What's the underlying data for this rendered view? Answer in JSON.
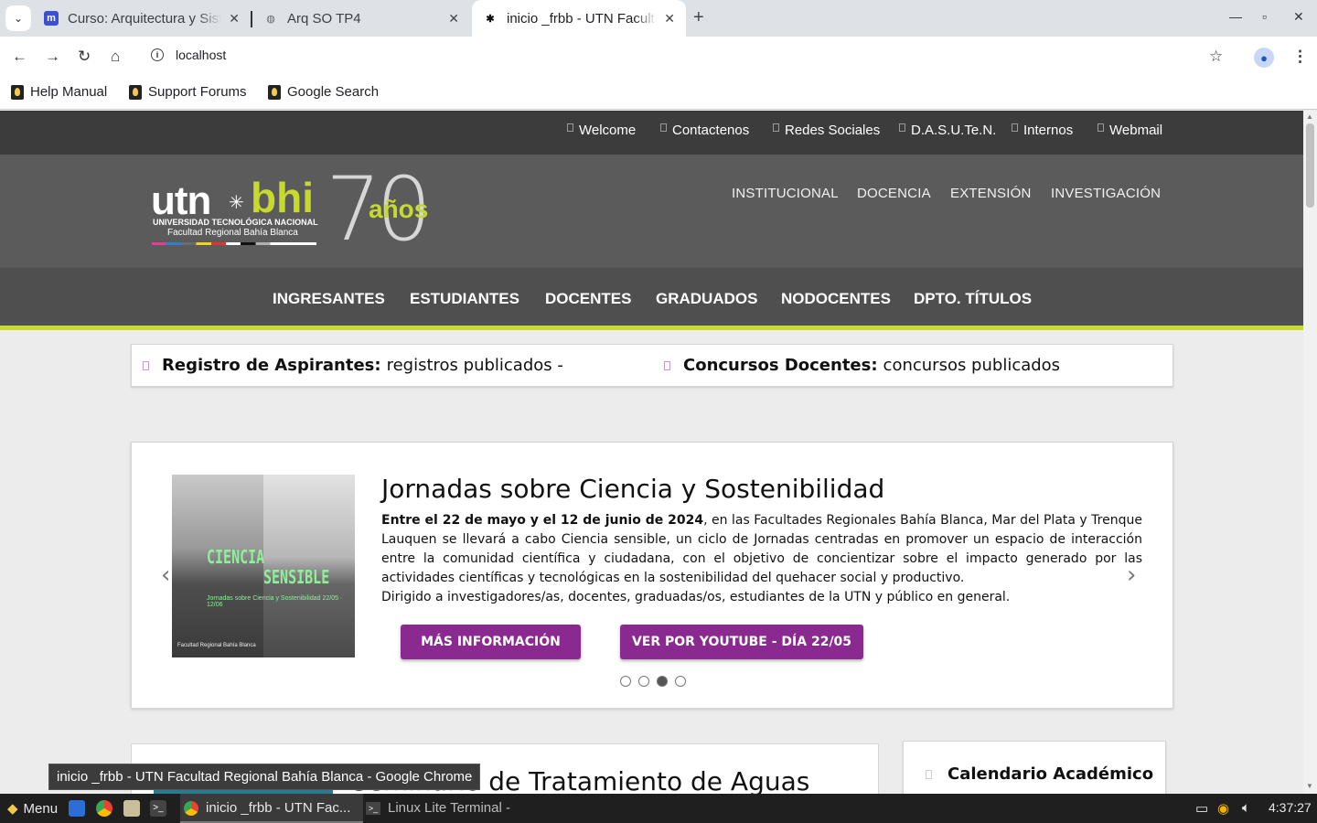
{
  "browser": {
    "tabs": [
      {
        "title": "Curso: Arquitectura y Sistemas Operativos",
        "favicon": "moodle-icon"
      },
      {
        "title": "Arq SO TP4",
        "favicon": "globe-icon"
      },
      {
        "title": "inicio _frbb - UTN Facultad Regional Bahía Blanca",
        "favicon": "utn-icon"
      }
    ],
    "url": "localhost",
    "bookmarks": [
      "Help Manual",
      "Support Forums",
      "Google Search"
    ]
  },
  "site": {
    "top_links": [
      "Welcome",
      "Contactenos",
      "Redes Sociales",
      "D.A.S.U.Te.N.",
      "Internos",
      "Webmail"
    ],
    "logo": {
      "utn": "utn",
      "bhi": "bhi",
      "line1": "UNIVERSIDAD TECNOLÓGICA NACIONAL",
      "line2": "Facultad Regional Bahía Blanca",
      "seventy": "70",
      "anos": "años"
    },
    "header_nav": [
      "INSTITUCIONAL",
      "DOCENCIA",
      "EXTENSIÓN",
      "INVESTIGACIÓN"
    ],
    "main_nav": [
      "INGRESANTES",
      "ESTUDIANTES",
      "DOCENTES",
      "GRADUADOS",
      "NODOCENTES",
      "DPTO. TÍTULOS"
    ],
    "notices": [
      {
        "bold": "Registro de Aspirantes:",
        "text": "registros publicados -"
      },
      {
        "bold": "Concursos Docentes:",
        "text": "concursos publicados"
      }
    ],
    "slide": {
      "image_text1": "CIENCIA",
      "image_text2": "SENSIBLE",
      "image_text3": "Jornadas sobre Ciencia y Sostenibilidad 22/05 · 12/06",
      "image_text4": "Facultad Regional Bahía Blanca",
      "title": "Jornadas sobre Ciencia y Sostenibilidad",
      "lead_bold": "Entre el 22 de mayo y el 12 de junio de 2024",
      "lead": ", en las Facultades Regionales Bahía Blanca, Mar del Plata y Trenque Lauquen se llevará a cabo Ciencia sensible, un ciclo de Jornadas centradas en promover un espacio de interacción entre la comunidad científica y ciudadana, con el objetivo de concientizar sobre el impacto generado por las actividades científicas y tecnológicas en la sostenibilidad del quehacer social y productivo.",
      "second": "Dirigido a investigadores/as, docentes, graduadas/os, estudiantes de la UTN y público en general.",
      "button1": "MÁS INFORMACIÓN",
      "button2": "VER POR YOUTUBE - DÍA 22/05",
      "active_dot": 3,
      "dot_count": 4
    },
    "card_title": "Seminario de Tratamiento de Aguas",
    "calendar_title": "Calendario Académico"
  },
  "tooltip": "inicio _frbb - UTN Facultad Regional Bahía Blanca - Google Chrome",
  "taskbar": {
    "menu": "Menu",
    "chrome_window": "inicio _frbb - UTN Fac...",
    "terminal_window": "Linux Lite Terminal -",
    "clock": "4:37:27"
  },
  "colors": {
    "accent_green": "#c6d92e",
    "button_purple": "#8a2a90",
    "header_gray": "#5b5b5b"
  }
}
